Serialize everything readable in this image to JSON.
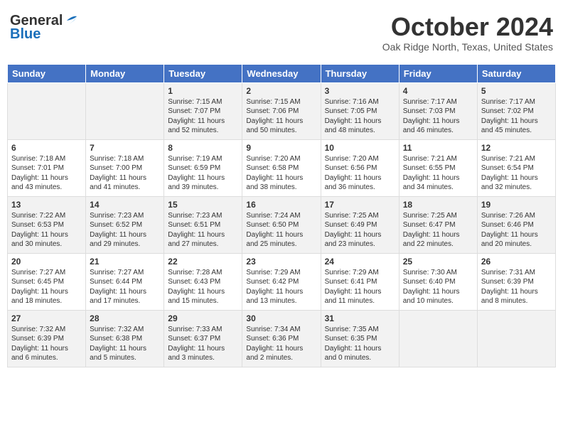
{
  "header": {
    "logo_line1": "General",
    "logo_line2": "Blue",
    "month": "October 2024",
    "location": "Oak Ridge North, Texas, United States"
  },
  "weekdays": [
    "Sunday",
    "Monday",
    "Tuesday",
    "Wednesday",
    "Thursday",
    "Friday",
    "Saturday"
  ],
  "weeks": [
    [
      {
        "day": "",
        "info": ""
      },
      {
        "day": "",
        "info": ""
      },
      {
        "day": "1",
        "info": "Sunrise: 7:15 AM\nSunset: 7:07 PM\nDaylight: 11 hours and 52 minutes."
      },
      {
        "day": "2",
        "info": "Sunrise: 7:15 AM\nSunset: 7:06 PM\nDaylight: 11 hours and 50 minutes."
      },
      {
        "day": "3",
        "info": "Sunrise: 7:16 AM\nSunset: 7:05 PM\nDaylight: 11 hours and 48 minutes."
      },
      {
        "day": "4",
        "info": "Sunrise: 7:17 AM\nSunset: 7:03 PM\nDaylight: 11 hours and 46 minutes."
      },
      {
        "day": "5",
        "info": "Sunrise: 7:17 AM\nSunset: 7:02 PM\nDaylight: 11 hours and 45 minutes."
      }
    ],
    [
      {
        "day": "6",
        "info": "Sunrise: 7:18 AM\nSunset: 7:01 PM\nDaylight: 11 hours and 43 minutes."
      },
      {
        "day": "7",
        "info": "Sunrise: 7:18 AM\nSunset: 7:00 PM\nDaylight: 11 hours and 41 minutes."
      },
      {
        "day": "8",
        "info": "Sunrise: 7:19 AM\nSunset: 6:59 PM\nDaylight: 11 hours and 39 minutes."
      },
      {
        "day": "9",
        "info": "Sunrise: 7:20 AM\nSunset: 6:58 PM\nDaylight: 11 hours and 38 minutes."
      },
      {
        "day": "10",
        "info": "Sunrise: 7:20 AM\nSunset: 6:56 PM\nDaylight: 11 hours and 36 minutes."
      },
      {
        "day": "11",
        "info": "Sunrise: 7:21 AM\nSunset: 6:55 PM\nDaylight: 11 hours and 34 minutes."
      },
      {
        "day": "12",
        "info": "Sunrise: 7:21 AM\nSunset: 6:54 PM\nDaylight: 11 hours and 32 minutes."
      }
    ],
    [
      {
        "day": "13",
        "info": "Sunrise: 7:22 AM\nSunset: 6:53 PM\nDaylight: 11 hours and 30 minutes."
      },
      {
        "day": "14",
        "info": "Sunrise: 7:23 AM\nSunset: 6:52 PM\nDaylight: 11 hours and 29 minutes."
      },
      {
        "day": "15",
        "info": "Sunrise: 7:23 AM\nSunset: 6:51 PM\nDaylight: 11 hours and 27 minutes."
      },
      {
        "day": "16",
        "info": "Sunrise: 7:24 AM\nSunset: 6:50 PM\nDaylight: 11 hours and 25 minutes."
      },
      {
        "day": "17",
        "info": "Sunrise: 7:25 AM\nSunset: 6:49 PM\nDaylight: 11 hours and 23 minutes."
      },
      {
        "day": "18",
        "info": "Sunrise: 7:25 AM\nSunset: 6:47 PM\nDaylight: 11 hours and 22 minutes."
      },
      {
        "day": "19",
        "info": "Sunrise: 7:26 AM\nSunset: 6:46 PM\nDaylight: 11 hours and 20 minutes."
      }
    ],
    [
      {
        "day": "20",
        "info": "Sunrise: 7:27 AM\nSunset: 6:45 PM\nDaylight: 11 hours and 18 minutes."
      },
      {
        "day": "21",
        "info": "Sunrise: 7:27 AM\nSunset: 6:44 PM\nDaylight: 11 hours and 17 minutes."
      },
      {
        "day": "22",
        "info": "Sunrise: 7:28 AM\nSunset: 6:43 PM\nDaylight: 11 hours and 15 minutes."
      },
      {
        "day": "23",
        "info": "Sunrise: 7:29 AM\nSunset: 6:42 PM\nDaylight: 11 hours and 13 minutes."
      },
      {
        "day": "24",
        "info": "Sunrise: 7:29 AM\nSunset: 6:41 PM\nDaylight: 11 hours and 11 minutes."
      },
      {
        "day": "25",
        "info": "Sunrise: 7:30 AM\nSunset: 6:40 PM\nDaylight: 11 hours and 10 minutes."
      },
      {
        "day": "26",
        "info": "Sunrise: 7:31 AM\nSunset: 6:39 PM\nDaylight: 11 hours and 8 minutes."
      }
    ],
    [
      {
        "day": "27",
        "info": "Sunrise: 7:32 AM\nSunset: 6:39 PM\nDaylight: 11 hours and 6 minutes."
      },
      {
        "day": "28",
        "info": "Sunrise: 7:32 AM\nSunset: 6:38 PM\nDaylight: 11 hours and 5 minutes."
      },
      {
        "day": "29",
        "info": "Sunrise: 7:33 AM\nSunset: 6:37 PM\nDaylight: 11 hours and 3 minutes."
      },
      {
        "day": "30",
        "info": "Sunrise: 7:34 AM\nSunset: 6:36 PM\nDaylight: 11 hours and 2 minutes."
      },
      {
        "day": "31",
        "info": "Sunrise: 7:35 AM\nSunset: 6:35 PM\nDaylight: 11 hours and 0 minutes."
      },
      {
        "day": "",
        "info": ""
      },
      {
        "day": "",
        "info": ""
      }
    ]
  ]
}
